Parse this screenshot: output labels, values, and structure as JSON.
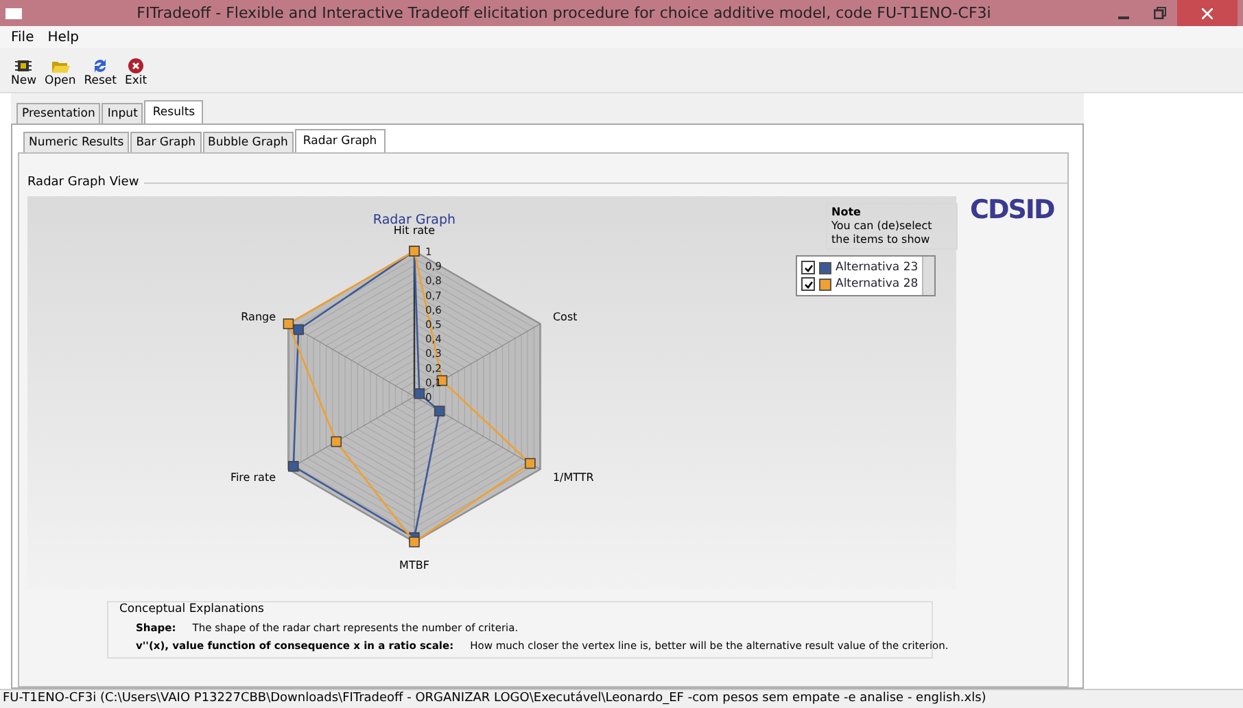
{
  "window": {
    "title": "FITradeoff - Flexible and Interactive Tradeoff elicitation  procedure for choice additive model, code FU-T1ENO-CF3i"
  },
  "menu": [
    "File",
    "Help"
  ],
  "toolbar": [
    {
      "kind": "new",
      "label": "New"
    },
    {
      "kind": "open",
      "label": "Open"
    },
    {
      "kind": "reset",
      "label": "Reset"
    },
    {
      "kind": "exit",
      "label": "Exit"
    }
  ],
  "tabs": [
    {
      "label": "Presentation",
      "selected": false
    },
    {
      "label": "Input",
      "selected": false
    },
    {
      "label": "Results",
      "selected": true
    }
  ],
  "subtabs": [
    {
      "label": "Numeric Results",
      "selected": false
    },
    {
      "label": "Bar Graph",
      "selected": false
    },
    {
      "label": "Bubble Graph",
      "selected": false
    },
    {
      "label": "Radar Graph",
      "selected": true
    }
  ],
  "view_title": "Radar Graph View",
  "logo": {
    "text": "CDSID"
  },
  "radar": {
    "title": "Radar Graph",
    "axes": [
      "Hit rate",
      "Cost",
      "1/MTTR",
      "MTBF",
      "Fire rate",
      "Range"
    ],
    "ticks": [
      "1",
      "0,9",
      "0,8",
      "0,7",
      "0,6",
      "0,5",
      "0,4",
      "0,3",
      "0,2",
      "0,1",
      "0"
    ]
  },
  "note": {
    "title": "Note",
    "text": "You can (de)select the items to show"
  },
  "legend": [
    {
      "label": "Alternativa 23",
      "checked": true,
      "color": "#3d5a98"
    },
    {
      "label": "Alternativa 28",
      "checked": true,
      "color": "#f0a030"
    }
  ],
  "explanations": {
    "title": "Conceptual Explanations",
    "rows": [
      {
        "term": "Shape:",
        "text": "The shape of the radar chart represents the number of criteria."
      },
      {
        "term": "v''(x), value function of consequence x in a ratio scale:",
        "text": "How much closer the vertex line is, better will be the alternative result value of the criterion."
      }
    ]
  },
  "status_bar": "FU-T1ENO-CF3i (C:\\Users\\VAIO P13227CBB\\Downloads\\FITradeoff - ORGANIZAR LOGO\\Executável\\Leonardo_EF -com pesos sem empate -e analise - english.xls)"
}
